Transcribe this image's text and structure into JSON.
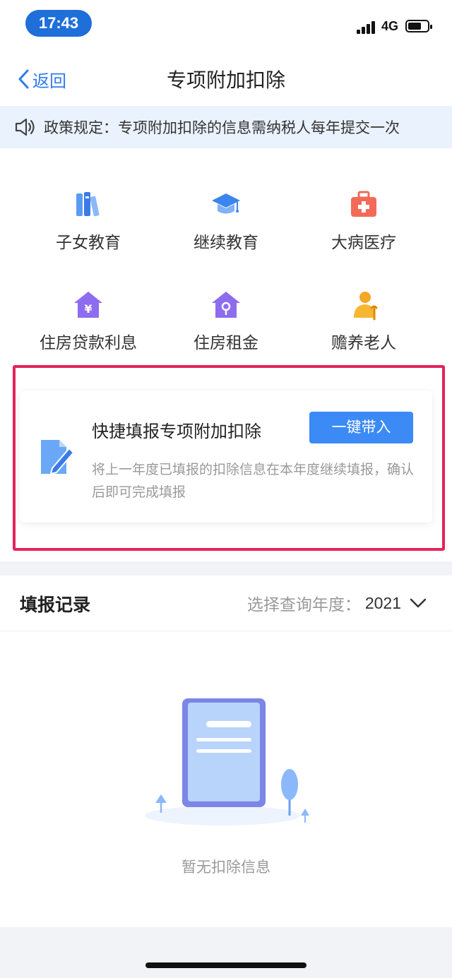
{
  "status_bar": {
    "time": "17:43",
    "network": "4G"
  },
  "nav": {
    "back_label": "返回",
    "title": "专项附加扣除"
  },
  "notice": {
    "text": "政策规定：专项附加扣除的信息需纳税人每年提交一次",
    "icon": "speaker-icon"
  },
  "categories": [
    {
      "label": "子女教育",
      "icon": "books-icon"
    },
    {
      "label": "继续教育",
      "icon": "graduation-cap-icon"
    },
    {
      "label": "大病医疗",
      "icon": "medical-kit-icon"
    },
    {
      "label": "住房贷款利息",
      "icon": "house-yen-icon"
    },
    {
      "label": "住房租金",
      "icon": "house-key-icon"
    },
    {
      "label": "赡养老人",
      "icon": "elderly-person-icon"
    }
  ],
  "quick_fill": {
    "title": "快捷填报专项附加扣除",
    "button_label": "一键带入",
    "description": "将上一年度已填报的扣除信息在本年度继续填报，确认后即可完成填报",
    "icon": "document-edit-icon"
  },
  "records": {
    "title": "填报记录",
    "year_label": "选择查询年度：",
    "year_value": "2021",
    "empty_text": "暂无扣除信息"
  },
  "colors": {
    "accent": "#3b8af6",
    "highlight": "#e5245c",
    "notice_bg": "#eaf2fd"
  }
}
